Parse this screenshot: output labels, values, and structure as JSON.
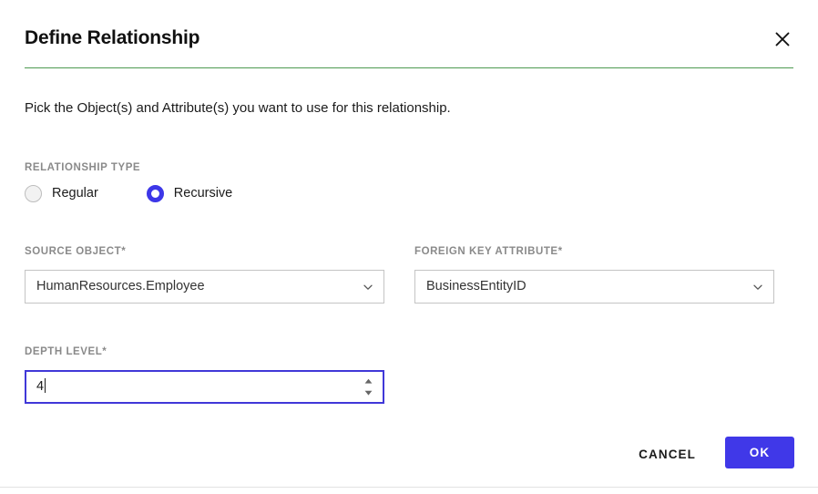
{
  "dialog": {
    "title": "Define Relationship",
    "close_icon": "close-icon",
    "description": "Pick the Object(s) and Attribute(s) you want to use for this relationship.",
    "divider_color": "#4e9a51",
    "accent_color": "#4038e8"
  },
  "relationship_type": {
    "label": "RELATIONSHIP TYPE",
    "options": [
      {
        "label": "Regular",
        "selected": false
      },
      {
        "label": "Recursive",
        "selected": true
      }
    ]
  },
  "source_object": {
    "label": "SOURCE OBJECT",
    "required_mark": "*",
    "value": "HumanResources.Employee",
    "chevron_icon": "chevron-down-icon"
  },
  "foreign_key_attribute": {
    "label": "FOREIGN KEY ATTRIBUTE",
    "required_mark": "*",
    "value": "BusinessEntityID",
    "chevron_icon": "chevron-down-icon"
  },
  "depth_level": {
    "label": "DEPTH LEVEL",
    "required_mark": "*",
    "value": "4",
    "focused": true,
    "spinner_icon": "spinner-updown-icon"
  },
  "footer": {
    "cancel_label": "CANCEL",
    "ok_label": "OK"
  }
}
